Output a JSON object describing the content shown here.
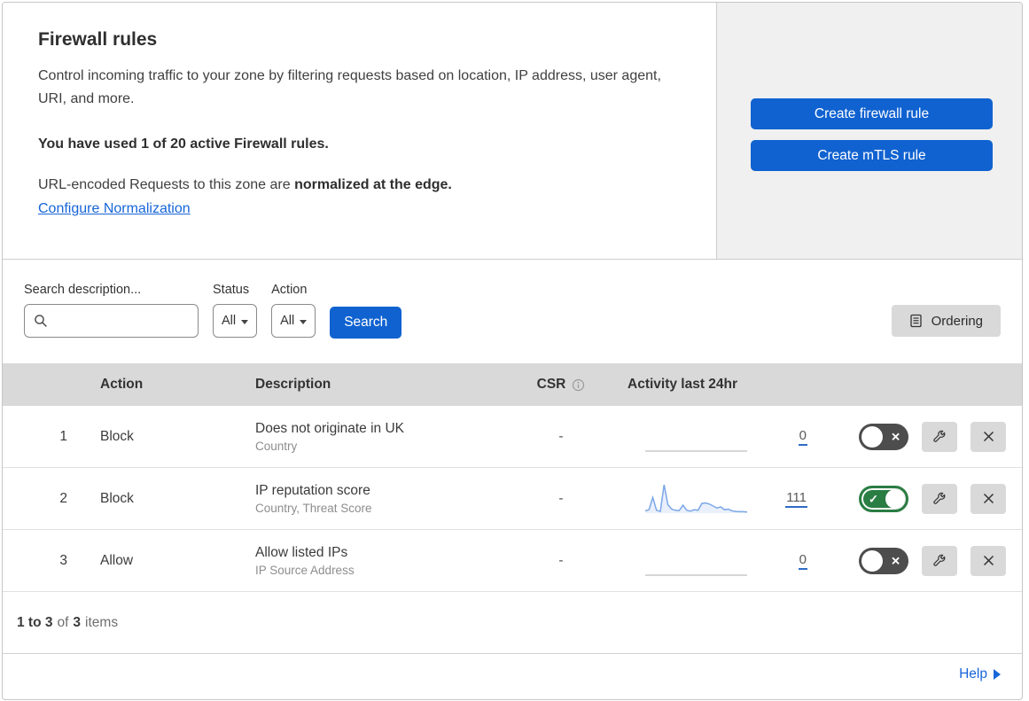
{
  "colors": {
    "accent_blue": "#1062d0",
    "link_blue": "#1765d8",
    "toggle_on_green": "#2a7d43",
    "toggle_off_gray": "#4d4d4d",
    "panel_gray": "#f0f0f0",
    "table_header_gray": "#d9d9d9",
    "spark_blue": "#7ba6e6"
  },
  "header": {
    "title": "Firewall rules",
    "description": "Control incoming traffic to your zone by filtering requests based on location, IP address, user agent, URI, and more.",
    "usage_note": "You have used 1 of 20 active Firewall rules.",
    "normalization_text": "URL-encoded Requests to this zone are",
    "normalization_bold": "normalized at the edge.",
    "normalization_link": "Configure Normalization",
    "create_firewall_rule_label": "Create firewall rule",
    "create_mtls_rule_label": "Create mTLS rule"
  },
  "filters": {
    "search_label": "Search description...",
    "status_label": "Status",
    "status_value": "All",
    "action_label": "Action",
    "action_value": "All",
    "search_button_label": "Search",
    "ordering_button_label": "Ordering"
  },
  "table": {
    "headers": {
      "action": "Action",
      "description": "Description",
      "csr": "CSR",
      "activity": "Activity last 24hr"
    },
    "rows": [
      {
        "priority": "1",
        "action": "Block",
        "description": "Does not originate in UK",
        "fields": "Country",
        "csr": "-",
        "activity_count": "0",
        "enabled": false,
        "spark": {
          "values": [
            0,
            0
          ],
          "line_color": "#c9c9c9",
          "fill_color": "none"
        }
      },
      {
        "priority": "2",
        "action": "Block",
        "description": "IP reputation score",
        "fields": "Country, Threat Score",
        "csr": "-",
        "activity_count": "111",
        "enabled": true,
        "spark": {
          "values": [
            8,
            12,
            55,
            10,
            6,
            100,
            30,
            14,
            10,
            9,
            28,
            10,
            7,
            12,
            10,
            34,
            36,
            32,
            25,
            18,
            22,
            12,
            14,
            8,
            6,
            5,
            5,
            4
          ],
          "line_color": "#7ba6e6",
          "fill_color": "#e9f0fb"
        }
      },
      {
        "priority": "3",
        "action": "Allow",
        "description": "Allow listed IPs",
        "fields": "IP Source Address",
        "csr": "-",
        "activity_count": "0",
        "enabled": false,
        "spark": {
          "values": [
            0,
            0
          ],
          "line_color": "#c9c9c9",
          "fill_color": "none"
        }
      }
    ]
  },
  "footer": {
    "range": "1 to 3",
    "of_text": "of",
    "total": "3",
    "items_text": "items",
    "help_label": "Help"
  }
}
